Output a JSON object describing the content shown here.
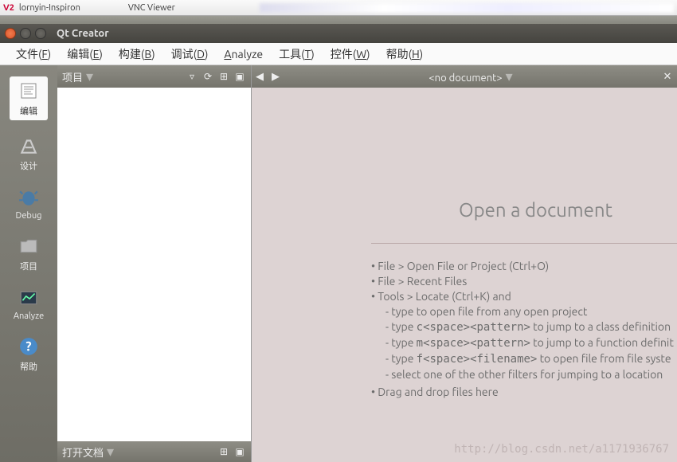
{
  "vnc": {
    "logo": "V2",
    "host": "lornyin-Inspiron",
    "app": "VNC Viewer"
  },
  "window": {
    "title": "Qt Creator"
  },
  "menubar": [
    {
      "label": "文件",
      "accel": "F"
    },
    {
      "label": "编辑",
      "accel": "E"
    },
    {
      "label": "构建",
      "accel": "B"
    },
    {
      "label": "调试",
      "accel": "D"
    },
    {
      "label": "Analyze",
      "accel": "A",
      "first": true
    },
    {
      "label": "工具",
      "accel": "T"
    },
    {
      "label": "控件",
      "accel": "W"
    },
    {
      "label": "帮助",
      "accel": "H"
    }
  ],
  "rail": [
    {
      "id": "edit",
      "label": "编辑",
      "active": true
    },
    {
      "id": "design",
      "label": "设计"
    },
    {
      "id": "debug",
      "label": "Debug"
    },
    {
      "id": "project",
      "label": "项目"
    },
    {
      "id": "analyze",
      "label": "Analyze"
    },
    {
      "id": "help",
      "label": "帮助"
    }
  ],
  "sidebar": {
    "header": "项目",
    "bottom": "打开文档"
  },
  "document": {
    "label": "<no document>"
  },
  "welcome": {
    "title": "Open a document",
    "l1": "• File > Open File or Project (Ctrl+O)",
    "l2": "• File > Recent Files",
    "l3": "• Tools > Locate (Ctrl+K) and",
    "s1": "- type to open file from any open project",
    "s2a": "- type ",
    "s2m": "c<space><pattern>",
    "s2b": " to jump to a class definition",
    "s3a": "- type ",
    "s3m": "m<space><pattern>",
    "s3b": " to jump to a function definit",
    "s4a": "- type ",
    "s4m": "f<space><filename>",
    "s4b": " to open file from file syste",
    "s5": "- select one of the other filters for jumping to a location",
    "l4": "• Drag and drop files here"
  },
  "watermark": "http://blog.csdn.net/a1171936767"
}
